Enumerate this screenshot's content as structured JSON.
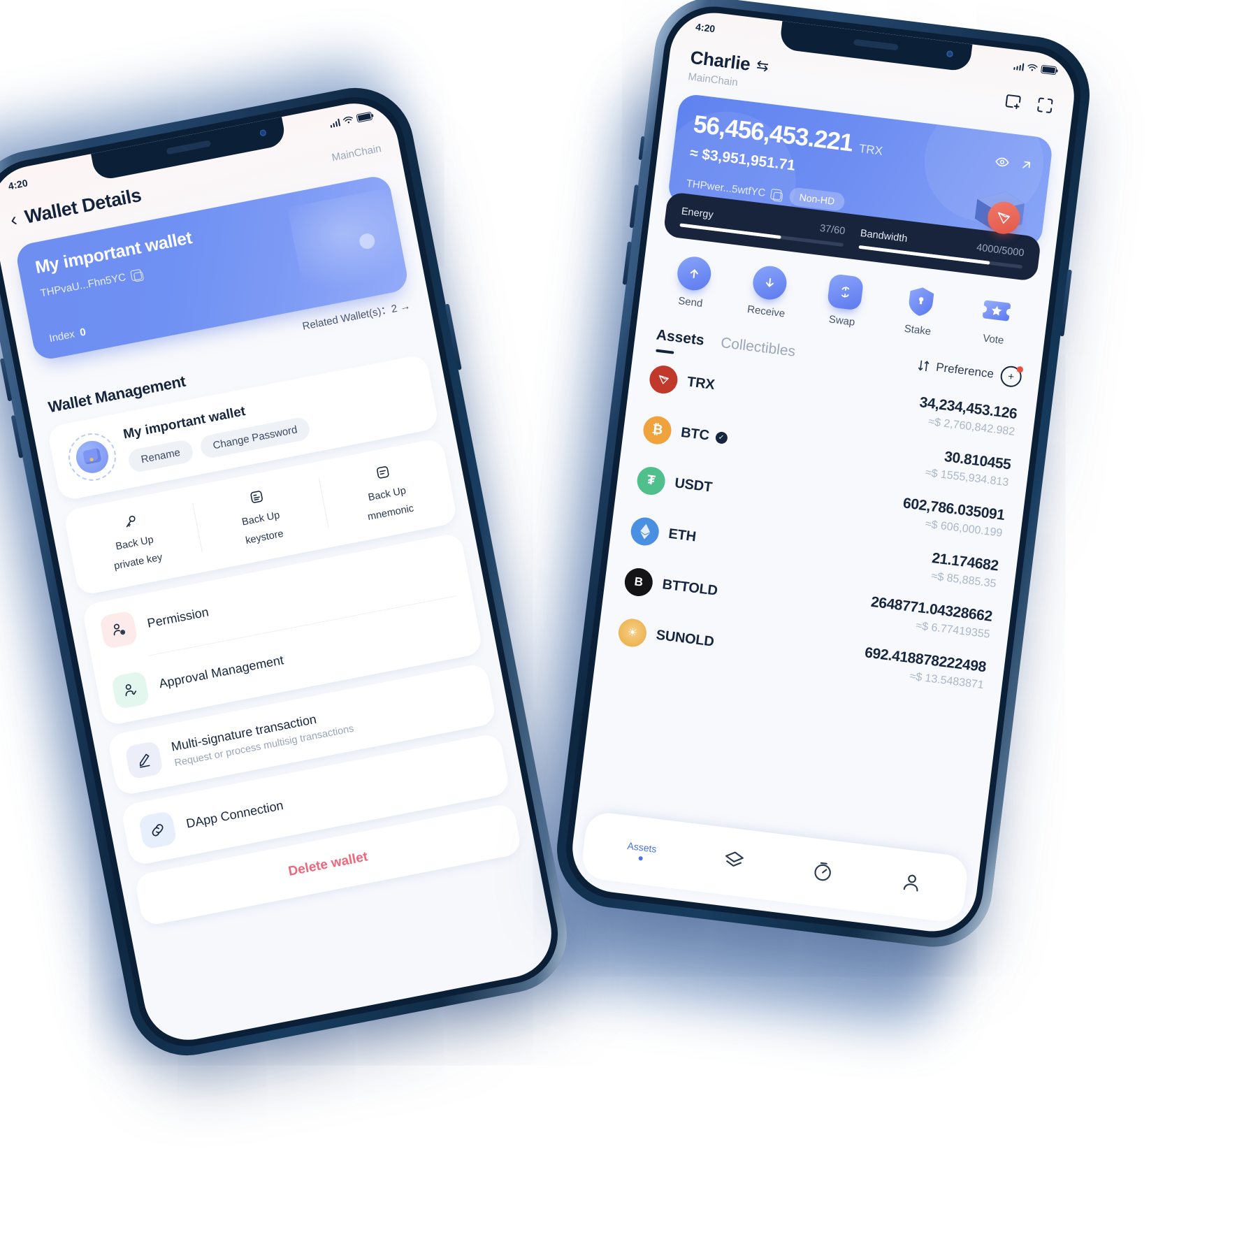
{
  "left_phone": {
    "status": {
      "time": "4:20",
      "signal_icon": "signal-bars-icon",
      "wifi_icon": "wifi-icon",
      "battery_icon": "battery-icon"
    },
    "header": {
      "back_icon": "chevron-left-icon",
      "title": "Wallet Details",
      "chain": "MainChain"
    },
    "wallet_card": {
      "name": "My important wallet",
      "address": "THPvaU...Fhn5YC",
      "copy_icon": "copy-icon",
      "index_label": "Index",
      "index_value": "0"
    },
    "related": "Related Wallet(s)：2  →",
    "section_title": "Wallet Management",
    "wallet_row": {
      "avatar_icon": "wallet-avatar-icon",
      "name": "My important wallet",
      "chips": [
        "Rename",
        "Change Password"
      ]
    },
    "backup": [
      {
        "icon": "key-icon",
        "label": "Back Up\nprivate key",
        "l1": "Back Up",
        "l2": "private key"
      },
      {
        "icon": "keystore-icon",
        "label": "Back Up keystore",
        "l1": "Back Up",
        "l2": "keystore"
      },
      {
        "icon": "mnemonic-icon",
        "label": "Back Up mnemonic",
        "l1": "Back Up",
        "l2": "mnemonic"
      }
    ],
    "menu": [
      {
        "icon": "permission-icon",
        "title": "Permission",
        "sub": ""
      },
      {
        "icon": "approval-icon",
        "title": "Approval Management",
        "sub": ""
      },
      {
        "icon": "multisig-icon",
        "title": "Multi-signature transaction",
        "sub": "Request or process multisig transactions"
      },
      {
        "icon": "link-icon",
        "title": "DApp Connection",
        "sub": ""
      }
    ],
    "delete_label": "Delete wallet"
  },
  "right_phone": {
    "status": {
      "time": "4:20",
      "signal_icon": "signal-bars-icon",
      "wifi_icon": "wifi-icon",
      "battery_icon": "battery-icon"
    },
    "header": {
      "account_name": "Charlie",
      "switch_icon": "switch-account-icon",
      "chain": "MainChain",
      "add_icon": "add-wallet-icon",
      "scan_icon": "scan-qr-icon"
    },
    "balance_card": {
      "amount": "56,456,453.221",
      "unit": "TRX",
      "usd": "≈ $3,951,951.71",
      "address": "THPwer...5wtfYC",
      "copy_icon": "copy-icon",
      "badge": "Non-HD",
      "eye_icon": "eye-icon",
      "share_icon": "arrow-up-right-icon",
      "wallet_art": "wallet-3d-icon",
      "tron_icon": "tron-logo-icon"
    },
    "resources": [
      {
        "label": "Energy",
        "value": "37",
        "max": "/60",
        "percent": 62
      },
      {
        "label": "Bandwidth",
        "value": "4000",
        "max": "/5000",
        "percent": 80
      }
    ],
    "actions": [
      {
        "icon": "arrow-up-icon",
        "label": "Send"
      },
      {
        "icon": "arrow-down-icon",
        "label": "Receive"
      },
      {
        "icon": "swap-icon",
        "label": "Swap"
      },
      {
        "icon": "shield-icon",
        "label": "Stake"
      },
      {
        "icon": "ticket-icon",
        "label": "Vote"
      }
    ],
    "tabs": [
      {
        "label": "Assets",
        "active": true
      },
      {
        "label": "Collectibles",
        "active": false
      }
    ],
    "preference": {
      "sort_icon": "sort-icon",
      "label": "Preference",
      "add_icon": "add-token-icon"
    },
    "assets": [
      {
        "symbol": "TRX",
        "glyph": "▶",
        "color": "#c0392b",
        "verified": false,
        "amount": "34,234,453.126",
        "usd": "≈$ 2,760,842.982"
      },
      {
        "symbol": "BTC",
        "glyph": "₿",
        "color": "#f0a23c",
        "verified": true,
        "amount": "30.810455",
        "usd": "≈$ 1555,934.813"
      },
      {
        "symbol": "USDT",
        "glyph": "₮",
        "color": "#4fbf8b",
        "verified": false,
        "amount": "602,786.035091",
        "usd": "≈$ 606,000.199"
      },
      {
        "symbol": "ETH",
        "glyph": "◆",
        "color": "#4a90e2",
        "verified": false,
        "amount": "21.174682",
        "usd": "≈$ 85,885.35"
      },
      {
        "symbol": "BTTOLD",
        "glyph": "B",
        "color": "#1d1d1f",
        "verified": false,
        "amount": "2648771.04328662",
        "usd": "≈$ 6.77419355"
      },
      {
        "symbol": "SUNOLD",
        "glyph": "☀",
        "color": "#f2b23c",
        "verified": false,
        "amount": "692.418878222498",
        "usd": "≈$ 13.5483871"
      }
    ],
    "bottom_nav": [
      {
        "icon": "assets-icon",
        "label": "Assets",
        "active": true
      },
      {
        "icon": "layers-icon",
        "label": "",
        "active": false
      },
      {
        "icon": "explore-icon",
        "label": "",
        "active": false
      },
      {
        "icon": "profile-icon",
        "label": "",
        "active": false
      }
    ]
  }
}
